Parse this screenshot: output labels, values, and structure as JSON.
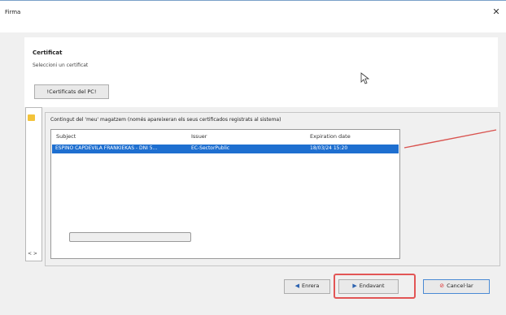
{
  "window": {
    "title": "Firma",
    "close_glyph": "✕"
  },
  "header": {
    "title": "Certificat",
    "subtitle": "Seleccioni un certificat",
    "pc_button_label": "!Certificats del PC!"
  },
  "panel": {
    "label": "Contingut del 'meu' magatzem (només apareixeran els seus certificados registrats al sistema)",
    "nav_arrows": "< >",
    "columns": [
      "Subject",
      "Issuer",
      "Expiration date"
    ],
    "rows": [
      {
        "subject": "ESPINO CAPDEVILA FRANKIEKAS - DNI 5...",
        "issuer": "EC-SectorPublic",
        "expiration": "18/03/24 15:20",
        "selected": true
      }
    ]
  },
  "buttons": {
    "prev_label": "Enrera",
    "next_label": "Endavant",
    "cancel_label": "Cancel·lar"
  },
  "icons": {
    "prev": "arrow-left-icon",
    "next": "arrow-right-icon",
    "cancel": "cancel-icon",
    "folder": "folder-icon",
    "cursor": "mouse-cursor-icon"
  },
  "colors": {
    "selection": "#1e6fd0",
    "highlight": "#e25555",
    "annotation": "#d9534f"
  }
}
